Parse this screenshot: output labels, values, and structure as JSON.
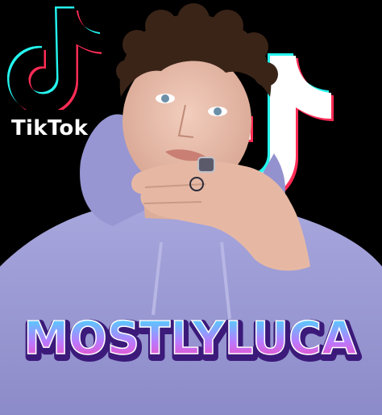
{
  "brand": {
    "name": "TikTok"
  },
  "title": {
    "text": "MOSTLYLUCA"
  },
  "colors": {
    "background": "#000000",
    "tiktok_cyan": "#25f4ee",
    "tiktok_red": "#fe2c55",
    "hoodie": "#9e9dd6",
    "title_pink": "#ff3fb4",
    "title_cyan": "#35e6ff",
    "title_purple": "#3b1a7a"
  },
  "icons": {
    "logo": "tiktok-note-icon",
    "background_mark": "tiktok-note-icon"
  }
}
